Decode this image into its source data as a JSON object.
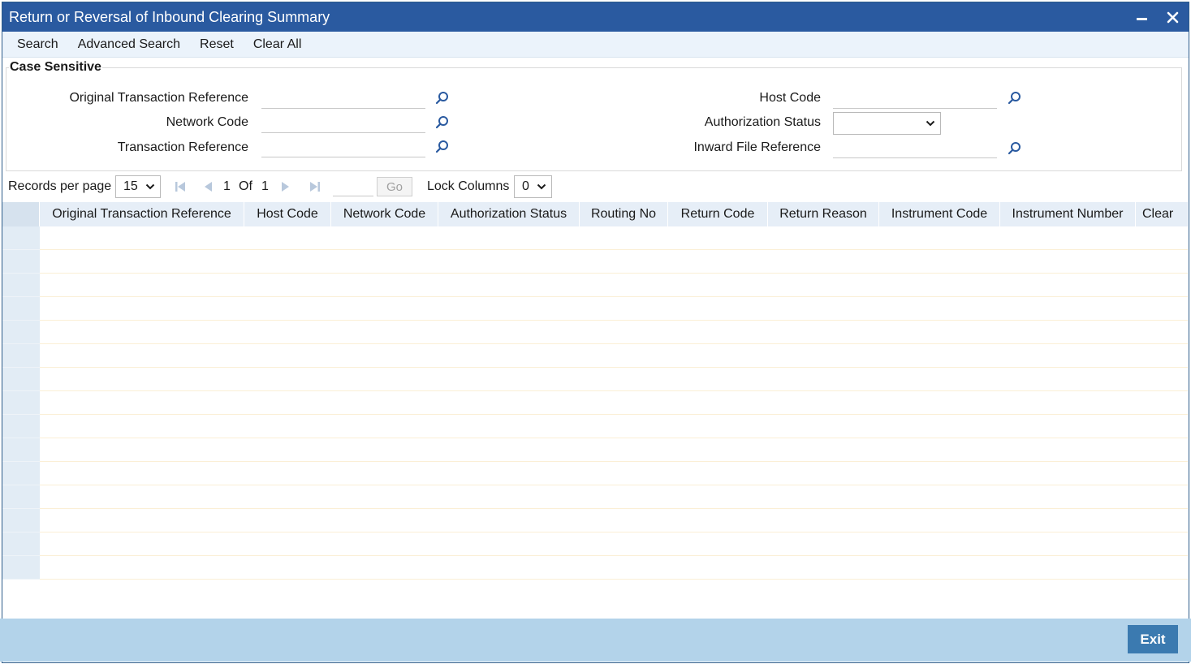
{
  "window": {
    "title": "Return or Reversal of Inbound Clearing Summary"
  },
  "toolbar": {
    "search": "Search",
    "advanced_search": "Advanced Search",
    "reset": "Reset",
    "clear_all": "Clear All"
  },
  "criteria": {
    "legend": "Case Sensitive",
    "original_transaction_reference": {
      "label": "Original Transaction Reference",
      "value": ""
    },
    "network_code": {
      "label": "Network Code",
      "value": ""
    },
    "transaction_reference": {
      "label": "Transaction Reference",
      "value": ""
    },
    "host_code": {
      "label": "Host Code",
      "value": ""
    },
    "authorization_status": {
      "label": "Authorization Status",
      "value": ""
    },
    "inward_file_reference": {
      "label": "Inward File Reference",
      "value": ""
    }
  },
  "pager": {
    "records_label": "Records per page",
    "records_value": "15",
    "current_page": "1",
    "of_label": "Of",
    "total_pages": "1",
    "go_label": "Go",
    "lock_label": "Lock Columns",
    "lock_value": "0"
  },
  "grid": {
    "columns": [
      "Original Transaction Reference",
      "Host Code",
      "Network Code",
      "Authorization Status",
      "Routing No",
      "Return Code",
      "Return Reason",
      "Instrument Code",
      "Instrument Number",
      "Clear"
    ],
    "row_count": 15
  },
  "footer": {
    "exit": "Exit"
  },
  "colors": {
    "titlebar": "#2a5aa0",
    "toolbar": "#ebf3fb",
    "footer": "#b3d3ea",
    "exit_button": "#3b7ab0",
    "lens": "#2a5aa0"
  }
}
